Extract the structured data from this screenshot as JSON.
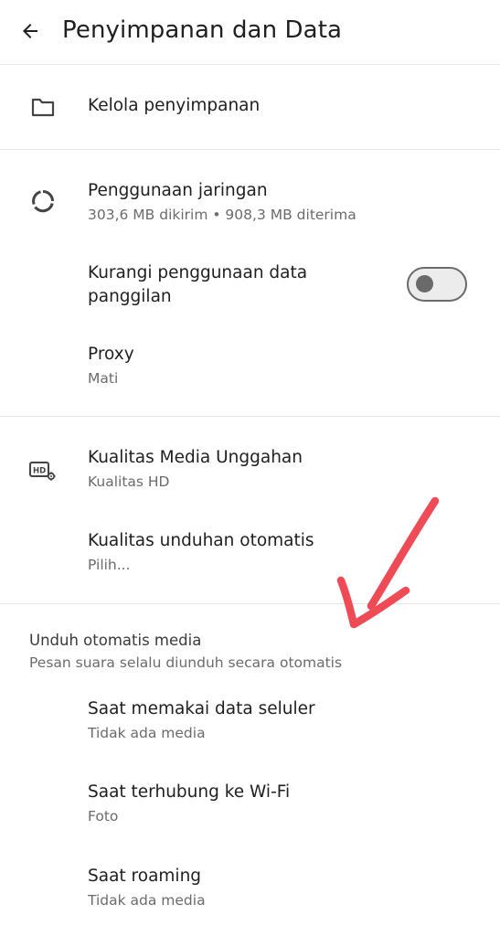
{
  "header": {
    "title": "Penyimpanan dan Data",
    "back_icon": "arrow-left-icon"
  },
  "storage": {
    "manage_label": "Kelola penyimpanan",
    "icon": "folder-icon"
  },
  "network": {
    "usage_label": "Penggunaan jaringan",
    "usage_detail": "303,6 MB dikirim • 908,3 MB diterima",
    "usage_icon": "data-usage-icon",
    "reduce_call_label_line1": "Kurangi penggunaan data",
    "reduce_call_label_line2": "panggilan",
    "reduce_call_enabled": false,
    "proxy_label": "Proxy",
    "proxy_value": "Mati"
  },
  "media_quality": {
    "upload_label": "Kualitas Media Unggahan",
    "upload_value": "Kualitas HD",
    "upload_icon": "hd-settings-icon",
    "auto_download_quality_label": "Kualitas unduhan otomatis",
    "auto_download_quality_value": "Pilih..."
  },
  "auto_download": {
    "section_title": "Unduh otomatis media",
    "section_subtitle": "Pesan suara selalu diunduh secara otomatis",
    "items": [
      {
        "label": "Saat memakai data seluler",
        "value": "Tidak ada media"
      },
      {
        "label": "Saat terhubung ke Wi-Fi",
        "value": "Foto"
      },
      {
        "label": "Saat roaming",
        "value": "Tidak ada media"
      }
    ]
  },
  "colors": {
    "annotation": "#ef4b57",
    "divider": "#e6e6e6",
    "secondary_text": "#6b6b6b"
  }
}
